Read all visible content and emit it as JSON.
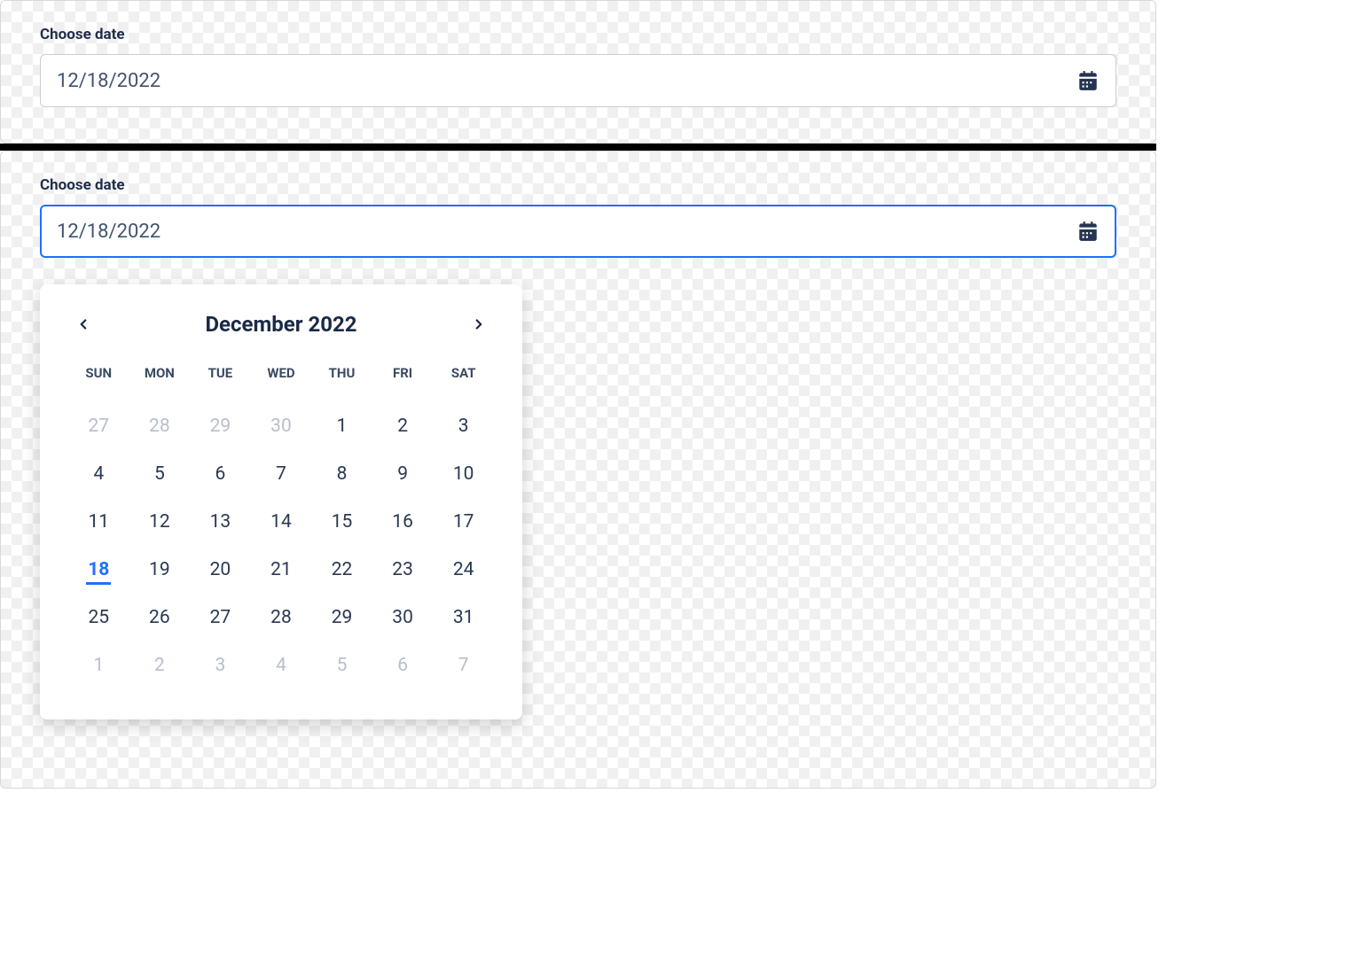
{
  "field1": {
    "label": "Choose date",
    "value": "12/18/2022"
  },
  "field2": {
    "label": "Choose date",
    "value": "12/18/2022"
  },
  "calendar": {
    "title": "December 2022",
    "weekdays": [
      "SUN",
      "MON",
      "TUE",
      "WED",
      "THU",
      "FRI",
      "SAT"
    ],
    "selected_day": 18,
    "weeks": [
      [
        {
          "d": 27,
          "other": true
        },
        {
          "d": 28,
          "other": true
        },
        {
          "d": 29,
          "other": true
        },
        {
          "d": 30,
          "other": true
        },
        {
          "d": 1
        },
        {
          "d": 2
        },
        {
          "d": 3
        }
      ],
      [
        {
          "d": 4
        },
        {
          "d": 5
        },
        {
          "d": 6
        },
        {
          "d": 7
        },
        {
          "d": 8
        },
        {
          "d": 9
        },
        {
          "d": 10
        }
      ],
      [
        {
          "d": 11
        },
        {
          "d": 12
        },
        {
          "d": 13
        },
        {
          "d": 14
        },
        {
          "d": 15
        },
        {
          "d": 16
        },
        {
          "d": 17
        }
      ],
      [
        {
          "d": 18,
          "selected": true
        },
        {
          "d": 19
        },
        {
          "d": 20
        },
        {
          "d": 21
        },
        {
          "d": 22
        },
        {
          "d": 23
        },
        {
          "d": 24
        }
      ],
      [
        {
          "d": 25
        },
        {
          "d": 26
        },
        {
          "d": 27
        },
        {
          "d": 28
        },
        {
          "d": 29
        },
        {
          "d": 30
        },
        {
          "d": 31
        }
      ],
      [
        {
          "d": 1,
          "other": true
        },
        {
          "d": 2,
          "other": true
        },
        {
          "d": 3,
          "other": true
        },
        {
          "d": 4,
          "other": true
        },
        {
          "d": 5,
          "other": true
        },
        {
          "d": 6,
          "other": true
        },
        {
          "d": 7,
          "other": true
        }
      ]
    ]
  }
}
